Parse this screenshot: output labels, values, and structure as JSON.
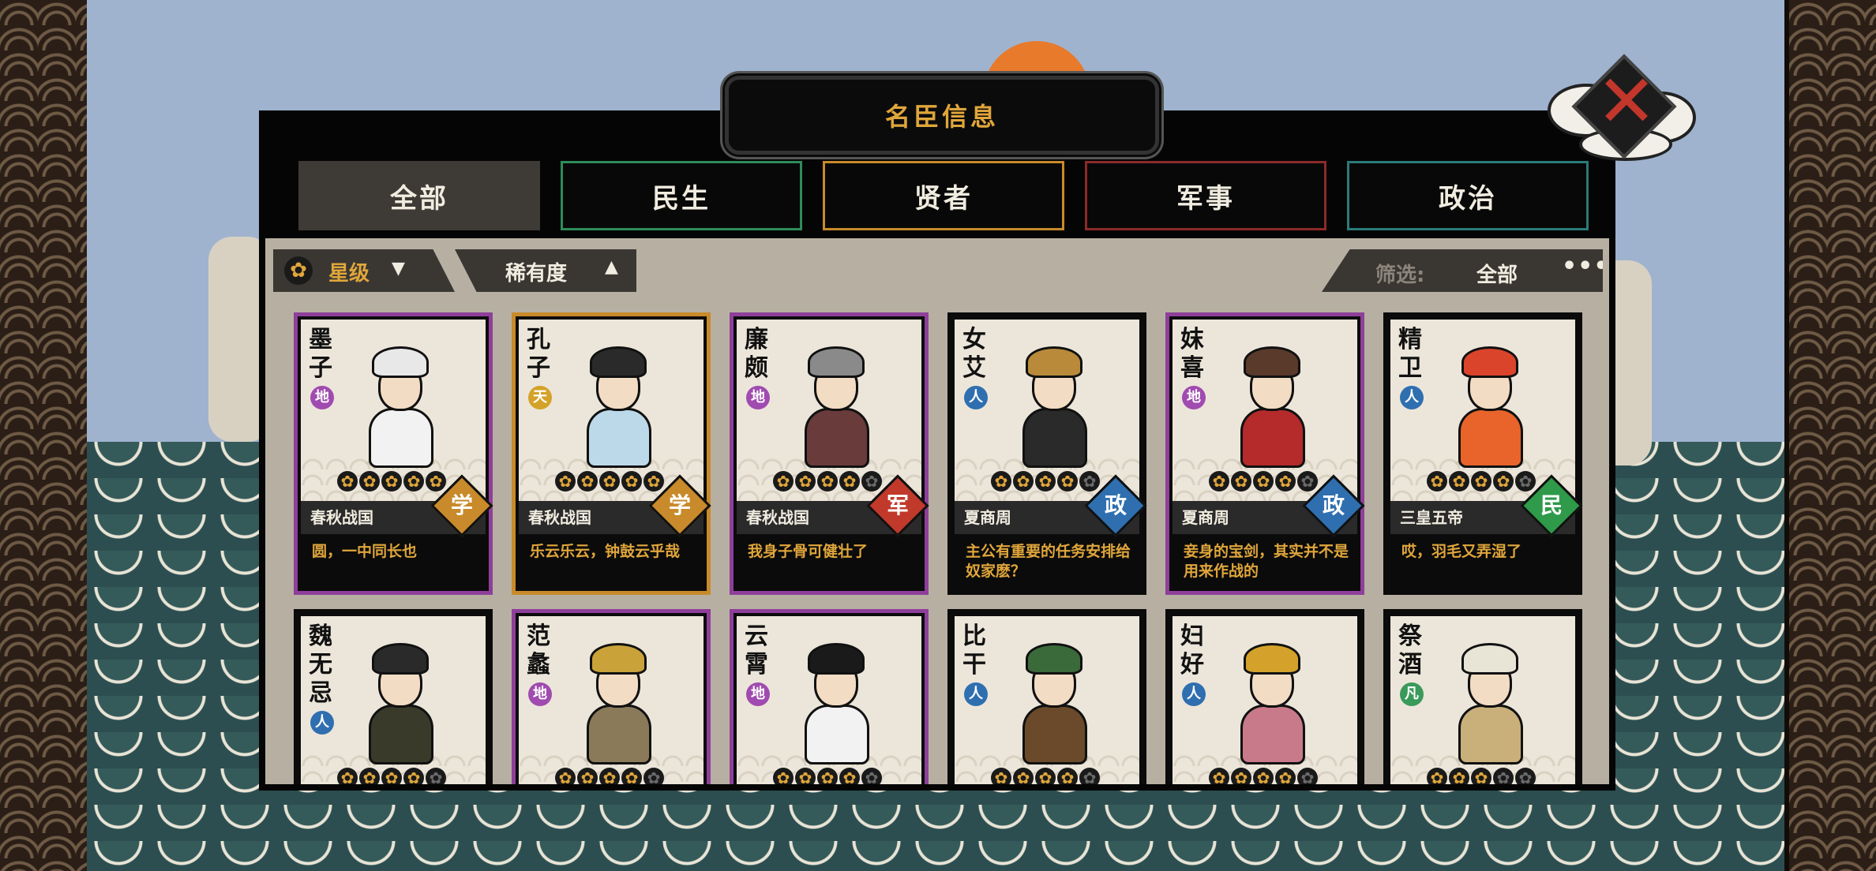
{
  "window": {
    "title": "名臣信息"
  },
  "tabs": [
    {
      "label": "全部",
      "color": "#3e3a35",
      "active": true
    },
    {
      "label": "民生",
      "color": "#2e8c5a",
      "active": false
    },
    {
      "label": "贤者",
      "color": "#c88a2a",
      "active": false
    },
    {
      "label": "军事",
      "color": "#8c2a2a",
      "active": false
    },
    {
      "label": "政治",
      "color": "#2a7a7a",
      "active": false
    }
  ],
  "sort": {
    "star_label": "星级",
    "rarity_label": "稀有度"
  },
  "filter": {
    "label": "筛选:",
    "value": "全部",
    "more": "•••"
  },
  "rarity_colors": {
    "purple": "#8e3f9a",
    "gold": "#c88a2a",
    "black": "#0b0b0b"
  },
  "category_colors": {
    "学": "#c88a2a",
    "军": "#c0392b",
    "政": "#2f6fb0",
    "民": "#2e9a4a"
  },
  "cards": [
    {
      "name": "墨子",
      "tier": "地",
      "tier_color": "#a04bb0",
      "rarity": "purple",
      "stars": 5,
      "era": "春秋战国",
      "category": "学",
      "quote": "圆，一中同长也",
      "hat": "#e8e8e8",
      "robe": "#f2f2f2"
    },
    {
      "name": "孔子",
      "tier": "天",
      "tier_color": "#d4a22a",
      "rarity": "gold",
      "stars": 5,
      "era": "春秋战国",
      "category": "学",
      "quote": "乐云乐云，钟鼓云乎哉",
      "hat": "#2a2a2a",
      "robe": "#bcd9ea"
    },
    {
      "name": "廉颇",
      "tier": "地",
      "tier_color": "#a04bb0",
      "rarity": "purple",
      "stars": 4,
      "era": "春秋战国",
      "category": "军",
      "quote": "我身子骨可健壮了",
      "hat": "#8a8a8a",
      "robe": "#6a3b3b"
    },
    {
      "name": "女艾",
      "tier": "人",
      "tier_color": "#2f6fb0",
      "rarity": "black",
      "stars": 4,
      "era": "夏商周",
      "category": "政",
      "quote": "主公有重要的任务安排给奴家麽？",
      "hat": "#b88a3a",
      "robe": "#2a2a2a"
    },
    {
      "name": "妺喜",
      "tier": "地",
      "tier_color": "#a04bb0",
      "rarity": "purple",
      "stars": 4,
      "era": "夏商周",
      "category": "政",
      "quote": "妾身的宝剑，其实并不是用来作战的",
      "hat": "#5a3a2a",
      "robe": "#b52a2a"
    },
    {
      "name": "精卫",
      "tier": "人",
      "tier_color": "#2f6fb0",
      "rarity": "black",
      "stars": 4,
      "era": "三皇五帝",
      "category": "民",
      "quote": "哎，羽毛又弄湿了",
      "hat": "#d9442a",
      "robe": "#e8642a"
    },
    {
      "name": "魏无忌",
      "tier": "人",
      "tier_color": "#2f6fb0",
      "rarity": "black",
      "stars": 4,
      "era": "",
      "category": "",
      "quote": "",
      "hat": "#2a2a2a",
      "robe": "#3a3a2a"
    },
    {
      "name": "范蠡",
      "tier": "地",
      "tier_color": "#a04bb0",
      "rarity": "purple",
      "stars": 4,
      "era": "",
      "category": "",
      "quote": "",
      "hat": "#c9a23a",
      "robe": "#8a7a5a"
    },
    {
      "name": "云霄",
      "tier": "地",
      "tier_color": "#a04bb0",
      "rarity": "purple",
      "stars": 4,
      "era": "",
      "category": "",
      "quote": "",
      "hat": "#1a1a1a",
      "robe": "#f2f2f2"
    },
    {
      "name": "比干",
      "tier": "人",
      "tier_color": "#2f6fb0",
      "rarity": "black",
      "stars": 4,
      "era": "",
      "category": "",
      "quote": "",
      "hat": "#3a6a3a",
      "robe": "#6a4a2a"
    },
    {
      "name": "妇好",
      "tier": "人",
      "tier_color": "#2f6fb0",
      "rarity": "black",
      "stars": 4,
      "era": "",
      "category": "",
      "quote": "",
      "hat": "#d4a22a",
      "robe": "#c97a8a"
    },
    {
      "name": "祭酒",
      "tier": "凡",
      "tier_color": "#3a9a5a",
      "rarity": "black",
      "stars": 3,
      "era": "",
      "category": "",
      "quote": "",
      "hat": "#e8e4d6",
      "robe": "#c9b07a"
    }
  ]
}
